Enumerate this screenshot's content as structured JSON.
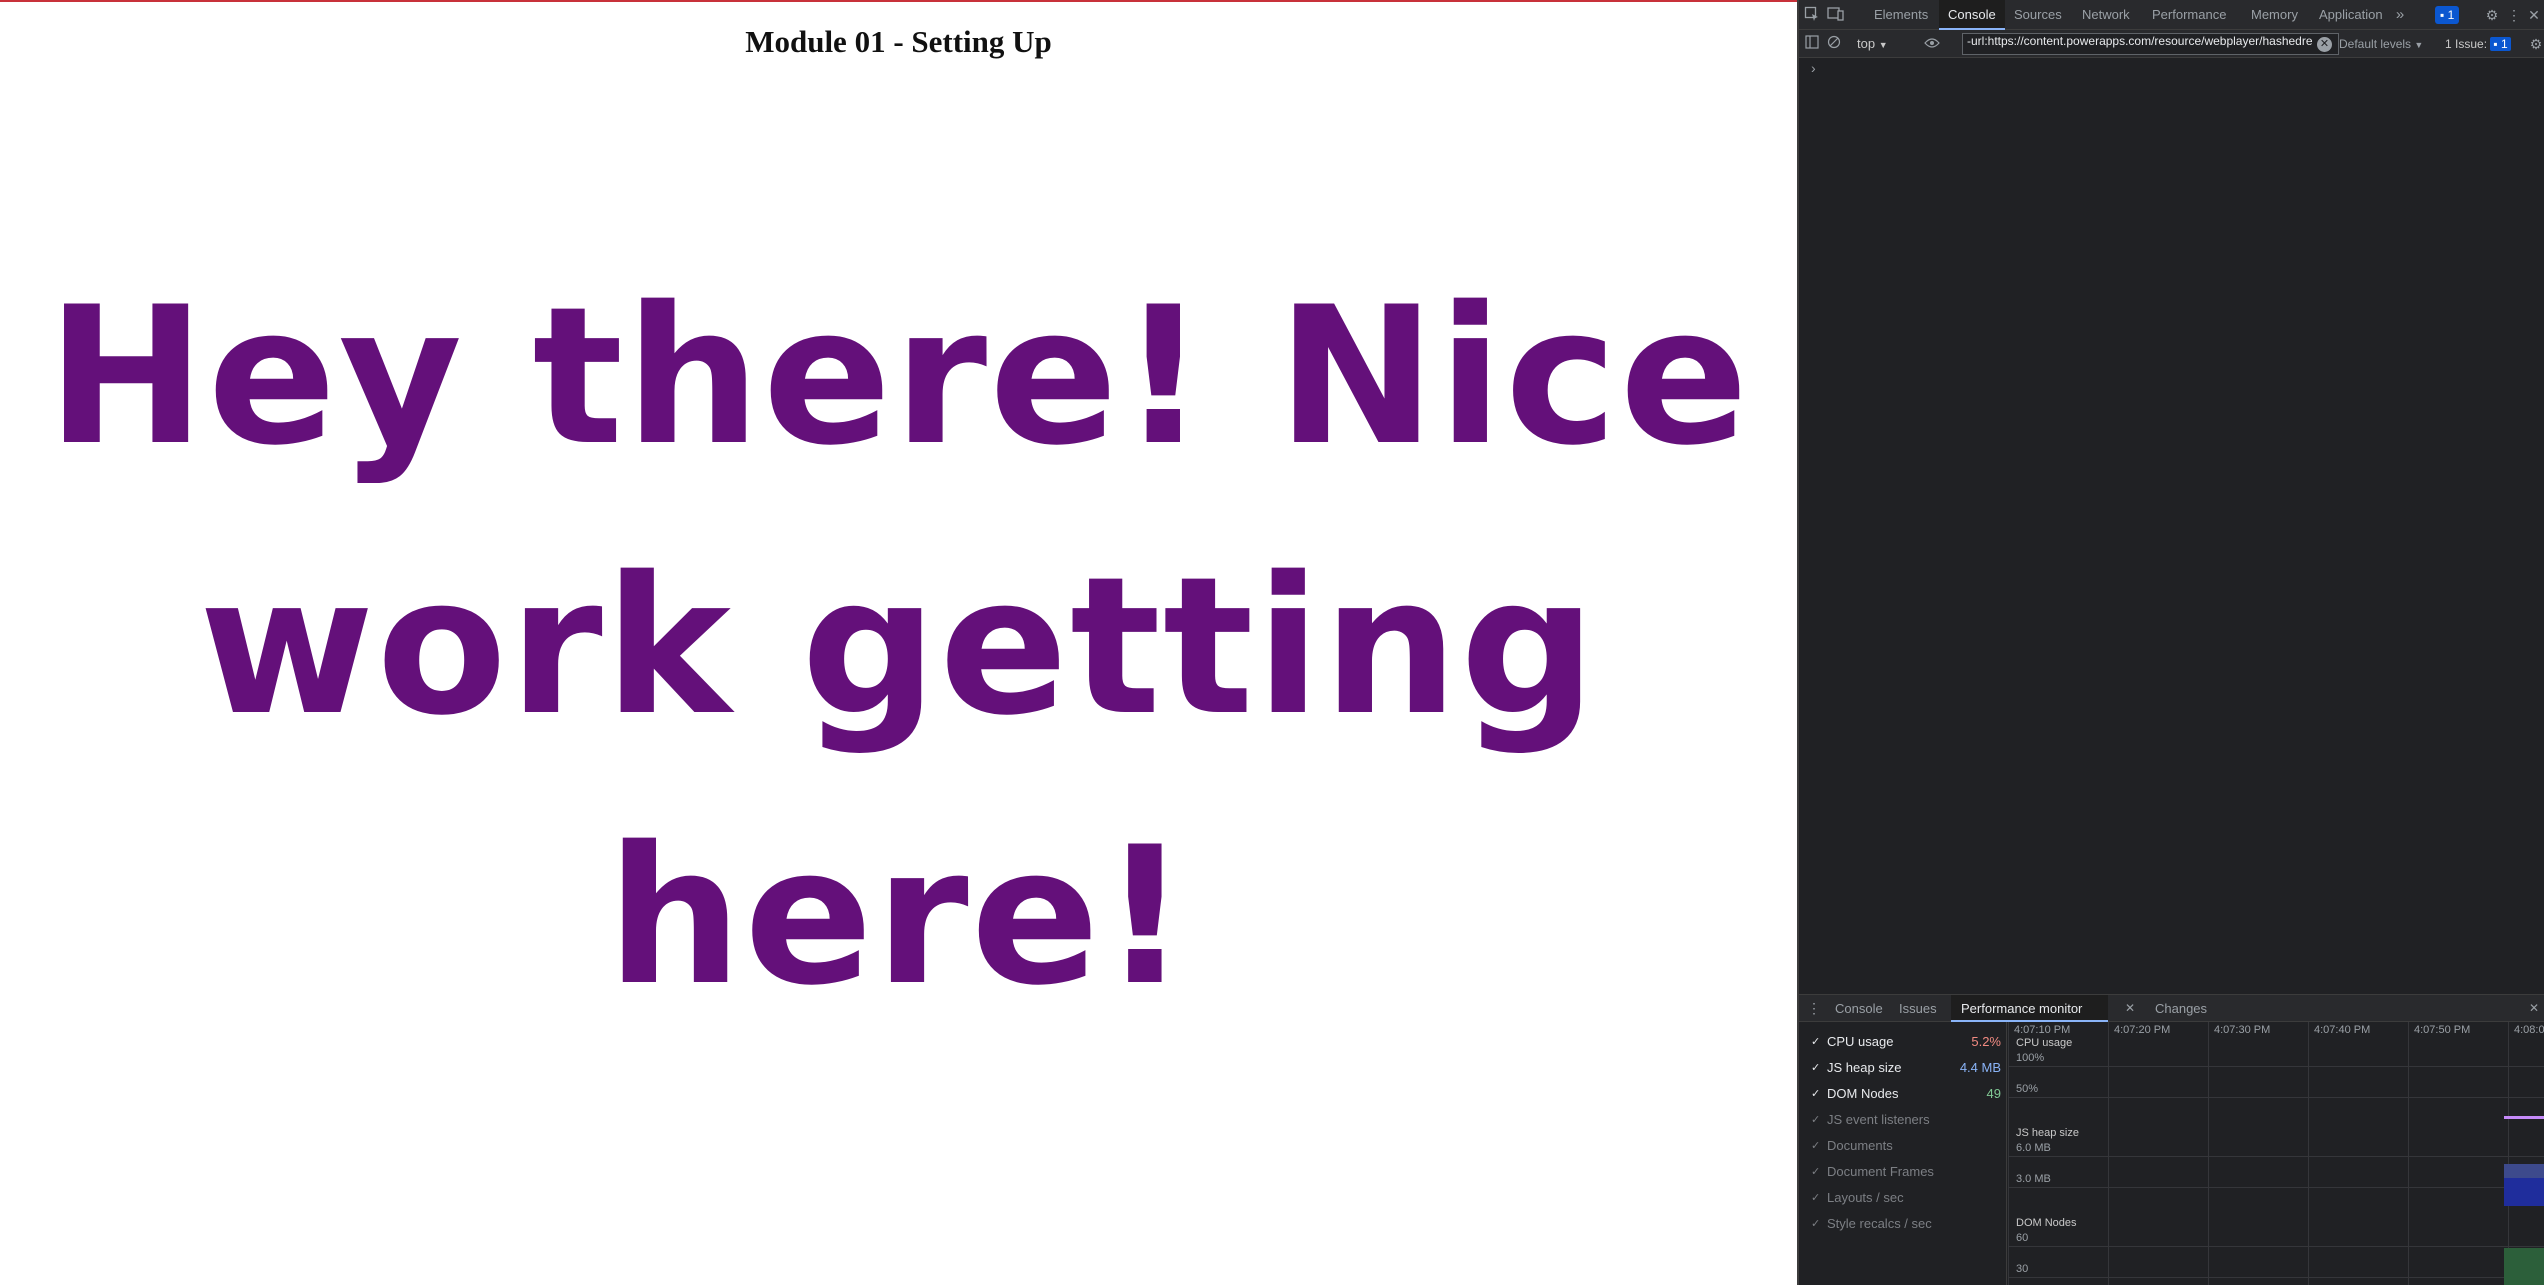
{
  "page": {
    "title": "Module 01 - Setting Up",
    "greeting_line1": "Hey there! Nice",
    "greeting_line2": "work getting here!",
    "accent_color": "#64107a"
  },
  "devtools": {
    "tabs": [
      "Elements",
      "Console",
      "Sources",
      "Network",
      "Performance",
      "Memory",
      "Application"
    ],
    "active_tab": "Console",
    "more_tabs_icon": "chevron-double-right-icon",
    "issues_badge": "1",
    "toolbar": {
      "context": "top",
      "filter_value": "-url:https://content.powerapps.com/resource/webplayer/hashedre",
      "levels": "Default levels",
      "issues": "1 Issue:",
      "issues_count": "1"
    },
    "prompt": "›",
    "drawer": {
      "tabs": [
        "Console",
        "Issues",
        "Performance monitor",
        "Changes"
      ],
      "active_tab": "Performance monitor"
    },
    "perf_monitor": {
      "metrics": [
        {
          "label": "CPU usage",
          "value": "5.2%",
          "enabled": true,
          "color": "#f28b82"
        },
        {
          "label": "JS heap size",
          "value": "4.4 MB",
          "enabled": true,
          "color": "#8ab4f8"
        },
        {
          "label": "DOM Nodes",
          "value": "49",
          "enabled": true,
          "color": "#81c995"
        },
        {
          "label": "JS event listeners",
          "value": "",
          "enabled": false
        },
        {
          "label": "Documents",
          "value": "",
          "enabled": false
        },
        {
          "label": "Document Frames",
          "value": "",
          "enabled": false
        },
        {
          "label": "Layouts / sec",
          "value": "",
          "enabled": false
        },
        {
          "label": "Style recalcs / sec",
          "value": "",
          "enabled": false
        }
      ],
      "times": [
        "4:07:10 PM",
        "4:07:20 PM",
        "4:07:30 PM",
        "4:07:40 PM",
        "4:07:50 PM",
        "4:08:0"
      ],
      "graphs": {
        "cpu": {
          "label": "CPU usage",
          "ticks": [
            "100%",
            "50%"
          ]
        },
        "heap": {
          "label": "JS heap size",
          "ticks": [
            "6.0 MB",
            "3.0 MB"
          ]
        },
        "dom": {
          "label": "DOM Nodes",
          "ticks": [
            "60",
            "30"
          ]
        }
      }
    }
  }
}
